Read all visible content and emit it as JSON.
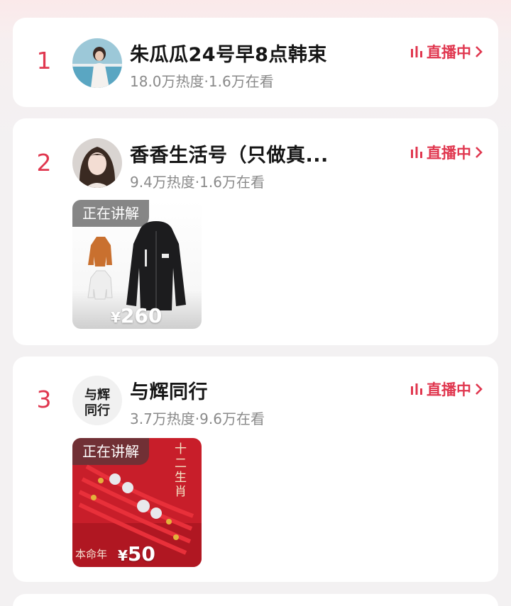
{
  "streams": [
    {
      "rank": "1",
      "name": "朱瓜瓜24号早8点韩束",
      "stats": "18.0万热度·1.6万在看",
      "live_label": "直播中"
    },
    {
      "rank": "2",
      "name": "香香生活号（只做真...",
      "stats": "9.4万热度·1.6万在看",
      "live_label": "直播中",
      "product": {
        "tag": "正在讲解",
        "currency": "¥",
        "price": "260"
      }
    },
    {
      "rank": "3",
      "name": "与辉同行",
      "stats": "3.7万热度·9.6万在看",
      "live_label": "直播中",
      "avatar_text": "与辉同行",
      "product": {
        "tag": "正在讲解",
        "currency": "¥",
        "price": "50",
        "corner_text": "本命年",
        "side_text": "十二生肖"
      }
    }
  ],
  "colors": {
    "accent": "#e0374f",
    "card": "#ffffff",
    "muted": "#8a8a8a"
  },
  "icons": {
    "live": "live-bars-icon",
    "chevron": "chevron-right-icon"
  }
}
